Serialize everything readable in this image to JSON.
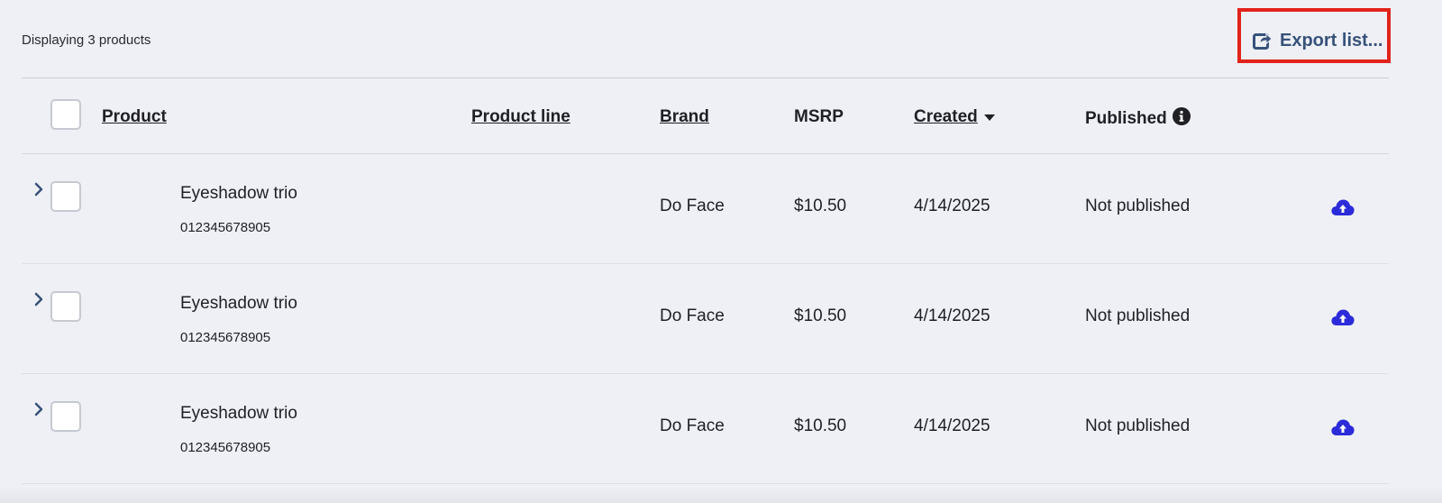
{
  "toolbar": {
    "count_text": "Displaying 3 products",
    "export_label": "Export list...",
    "export_icon": "share-export-icon",
    "highlight_color": "#e2231a",
    "link_color": "#37527a"
  },
  "table": {
    "headers": {
      "product": "Product",
      "product_line": "Product line",
      "brand": "Brand",
      "msrp": "MSRP",
      "created": "Created",
      "published": "Published"
    },
    "sort": {
      "column": "Created",
      "direction": "descending",
      "icon": "caret-down-icon"
    },
    "published_info_icon": "info-icon",
    "rows": [
      {
        "name": "Eyeshadow trio",
        "sku": "012345678905",
        "product_line": "",
        "brand": "Do Face",
        "msrp": "$10.50",
        "created": "4/14/2025",
        "published": "Not published",
        "action_icon": "cloud-upload-icon"
      },
      {
        "name": "Eyeshadow trio",
        "sku": "012345678905",
        "product_line": "",
        "brand": "Do Face",
        "msrp": "$10.50",
        "created": "4/14/2025",
        "published": "Not published",
        "action_icon": "cloud-upload-icon"
      },
      {
        "name": "Eyeshadow trio",
        "sku": "012345678905",
        "product_line": "",
        "brand": "Do Face",
        "msrp": "$10.50",
        "created": "4/14/2025",
        "published": "Not published",
        "action_icon": "cloud-upload-icon"
      }
    ],
    "upload_icon_color": "#2b2bd9"
  }
}
